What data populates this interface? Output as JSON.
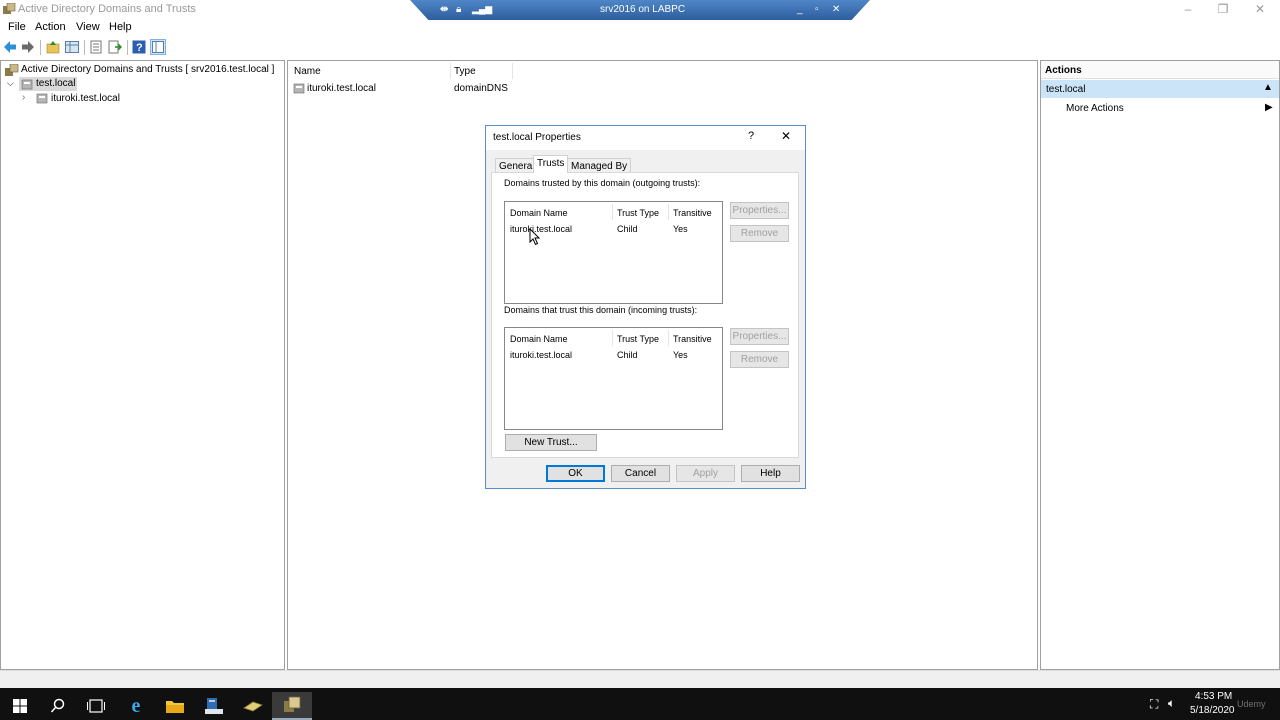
{
  "window": {
    "title": "Active Directory Domains and Trusts",
    "controls": {
      "minimize": "–",
      "maximize": "❐",
      "close": "✕"
    }
  },
  "rdp": {
    "title": "srv2016 on LABPC",
    "min": "_",
    "restore": "▫",
    "close": "✕"
  },
  "menu": {
    "items": [
      "File",
      "Action",
      "View",
      "Help"
    ]
  },
  "toolbar": {
    "icons": [
      "back-arrow-icon",
      "forward-arrow-icon",
      "up-folder-icon",
      "show-tree-icon",
      "properties-icon",
      "export-icon",
      "help-icon",
      "view-icon"
    ]
  },
  "tree": {
    "root": "Active Directory Domains and Trusts [ srv2016.test.local ]",
    "selected": "test.local",
    "child": "ituroki.test.local"
  },
  "list": {
    "columns": [
      "Name",
      "Type"
    ],
    "rows": [
      {
        "name": "ituroki.test.local",
        "type": "domainDNS"
      }
    ]
  },
  "actions": {
    "header": "Actions",
    "section": "test.local",
    "item": "More Actions"
  },
  "dialog": {
    "title": "test.local Properties",
    "help": "?",
    "close": "✕",
    "tabs": [
      "General",
      "Trusts",
      "Managed By"
    ],
    "active_tab": "Trusts",
    "outgoing": {
      "label": "Domains trusted by this domain (outgoing trusts):",
      "columns": [
        "Domain Name",
        "Trust Type",
        "Transitive"
      ],
      "rows": [
        [
          "ituroki.test.local",
          "Child",
          "Yes"
        ]
      ]
    },
    "incoming": {
      "label": "Domains that trust this domain (incoming trusts):",
      "columns": [
        "Domain Name",
        "Trust Type",
        "Transitive"
      ],
      "rows": [
        [
          "ituroki.test.local",
          "Child",
          "Yes"
        ]
      ]
    },
    "buttons": {
      "properties": "Properties...",
      "remove": "Remove",
      "new_trust": "New Trust...",
      "ok": "OK",
      "cancel": "Cancel",
      "apply": "Apply",
      "help": "Help"
    }
  },
  "taskbar": {
    "time": "4:53 PM",
    "date": "5/18/2020",
    "watermark": "Udemy"
  },
  "colors": {
    "rdp_bar": "#2e5e9e",
    "selection": "#d9d9d9",
    "taskbar": "#101010",
    "action_header": "#cce4f7"
  }
}
